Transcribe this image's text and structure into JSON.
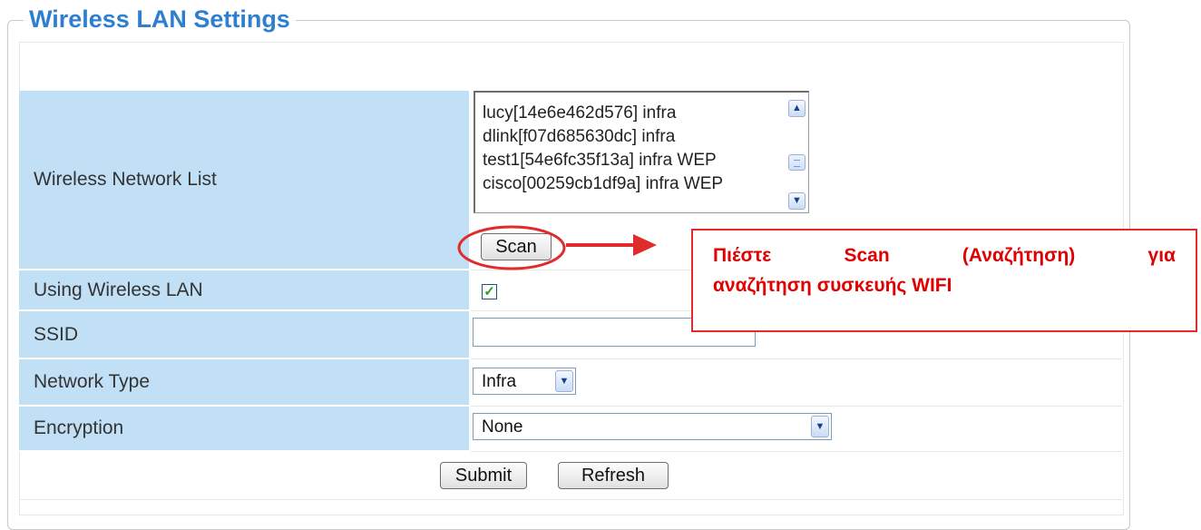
{
  "section_title": "Wireless LAN Settings",
  "network_list": {
    "label": "Wireless Network List",
    "items": [
      "lucy[14e6e462d576] infra",
      "dlink[f07d685630dc] infra",
      "test1[54e6fc35f13a] infra WEP",
      "cisco[00259cb1df9a] infra WEP"
    ],
    "scan_label": "Scan"
  },
  "using_wlan": {
    "label": "Using Wireless LAN",
    "checked": true
  },
  "ssid": {
    "label": "SSID",
    "value": ""
  },
  "network_type": {
    "label": "Network Type",
    "value": "Infra"
  },
  "encryption": {
    "label": "Encryption",
    "value": "None"
  },
  "actions": {
    "submit_label": "Submit",
    "refresh_label": "Refresh"
  },
  "annotation": {
    "line1_words": [
      "Πιέστε",
      "Scan",
      "(Αναζήτηση)",
      "για"
    ],
    "line2": "αναζήτηση συσκευής WIFI",
    "color": "#e00000"
  },
  "icons": {
    "scroll_up": "chevron-up-icon",
    "scroll_down": "chevron-down-icon",
    "select_arrow": "chevron-down-icon",
    "check": "checkmark-icon"
  }
}
